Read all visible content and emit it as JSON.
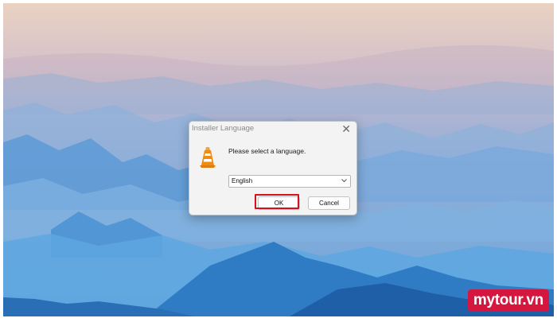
{
  "dialog": {
    "title": "Installer Language",
    "close_glyph": "✕",
    "prompt": "Please select a language.",
    "language_select": {
      "selected": "English"
    },
    "ok_label": "OK",
    "cancel_label": "Cancel",
    "icon": "vlc-cone-icon",
    "highlight_color": "#d6111e"
  },
  "watermark": {
    "text": "mytour.vn",
    "color": "#d5173f"
  },
  "colors": {
    "sky_top": "#e8cfbf",
    "sky_mid": "#b9b7d2",
    "mountains": "#3f8fd0"
  }
}
